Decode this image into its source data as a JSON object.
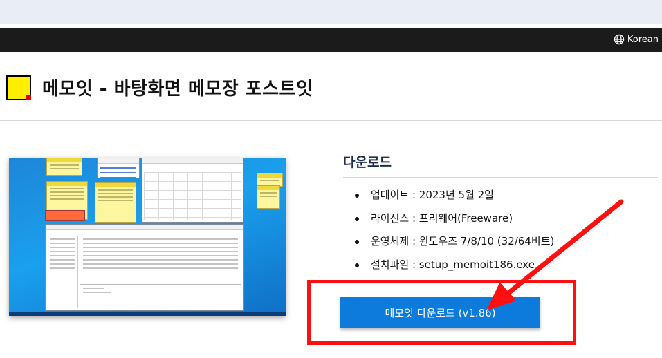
{
  "nav": {
    "language_label": "Korean"
  },
  "page": {
    "title": "메모잇 - 바탕화면 메모장 포스트잇"
  },
  "download": {
    "heading": "다운로드",
    "items": [
      {
        "text": "업데이트 : 2023년 5월 2일"
      },
      {
        "text": "라이선스 : 프리웨어(Freeware)"
      },
      {
        "text": "운영체제 : 윈도우즈 7/8/10 (32/64비트)"
      },
      {
        "text": "설치파일 : setup_memoit186.exe"
      }
    ],
    "button_label": "메모잇 다운로드 (v1.86)"
  },
  "colors": {
    "accent_button": "#0c7bdc",
    "annotation": "#ff1010",
    "nav_bg": "#1b1b1b",
    "icon_yellow": "#ffee00"
  },
  "icons": {
    "language": "globe-icon",
    "app": "memo-note-icon",
    "annotation_arrow": "red-arrow-icon"
  }
}
